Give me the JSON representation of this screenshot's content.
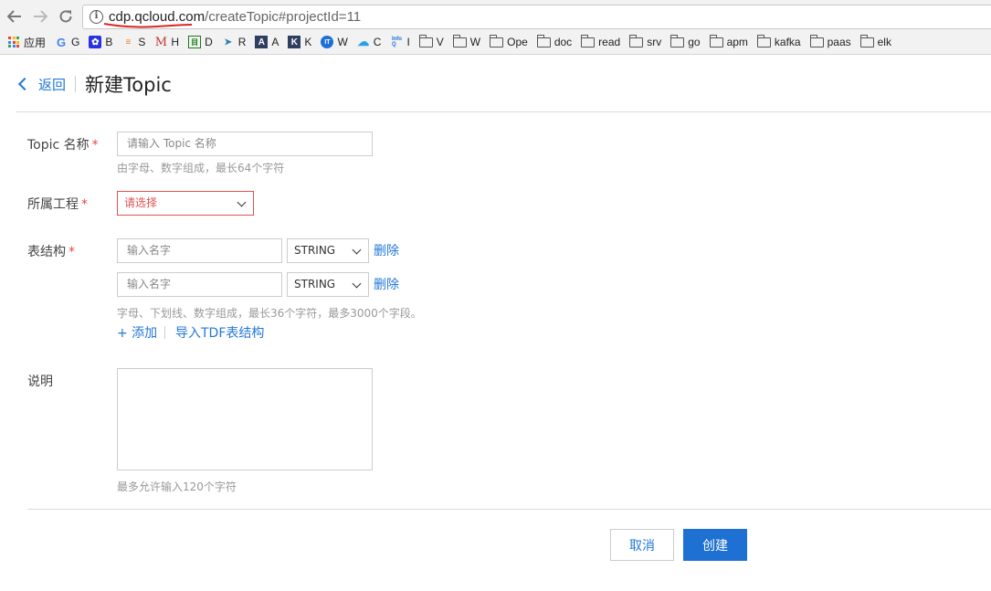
{
  "browser": {
    "url_host": "cdp.qcloud.com",
    "url_path": "/createTopic#projectId=11",
    "bookmarks": [
      {
        "icon": "apps-icon",
        "label": "应用"
      },
      {
        "icon": "google-icon",
        "label": "G"
      },
      {
        "icon": "baidu-paw-icon",
        "label": "B"
      },
      {
        "icon": "stack-icon",
        "label": "S"
      },
      {
        "icon": "m-logo-icon",
        "label": "H"
      },
      {
        "icon": "box-icon",
        "label": "D"
      },
      {
        "icon": "bird-icon",
        "label": "R"
      },
      {
        "icon": "a-logo-icon",
        "label": "A"
      },
      {
        "icon": "k-logo-icon",
        "label": "K"
      },
      {
        "icon": "it-icon",
        "label": "W"
      },
      {
        "icon": "cloud-icon",
        "label": "C"
      },
      {
        "icon": "infoq-icon",
        "label": "I"
      },
      {
        "icon": "folder-icon",
        "label": "V"
      },
      {
        "icon": "folder-icon",
        "label": "W"
      },
      {
        "icon": "folder-icon",
        "label": "Ope"
      },
      {
        "icon": "folder-icon",
        "label": "doc"
      },
      {
        "icon": "folder-icon",
        "label": "read"
      },
      {
        "icon": "folder-icon",
        "label": "srv"
      },
      {
        "icon": "folder-icon",
        "label": "go"
      },
      {
        "icon": "folder-icon",
        "label": "apm"
      },
      {
        "icon": "folder-icon",
        "label": "kafka"
      },
      {
        "icon": "folder-icon",
        "label": "paas"
      },
      {
        "icon": "folder-icon",
        "label": "elk"
      }
    ]
  },
  "header": {
    "back_label": "返回",
    "title": "新建Topic"
  },
  "form": {
    "topic_name": {
      "label": "Topic 名称",
      "required_mark": "*",
      "placeholder": "请输入 Topic 名称",
      "hint": "由字母、数字组成，最长64个字符"
    },
    "project": {
      "label": "所属工程",
      "required_mark": "*",
      "selected": "请选择"
    },
    "schema": {
      "label": "表结构",
      "required_mark": "*",
      "rows": [
        {
          "name_placeholder": "输入名字",
          "type": "STRING",
          "delete_label": "删除"
        },
        {
          "name_placeholder": "输入名字",
          "type": "STRING",
          "delete_label": "删除"
        }
      ],
      "hint": "字母、下划线、数字组成，最长36个字符，最多3000个字段。",
      "add_label": "+ 添加",
      "import_label": "导入TDF表结构"
    },
    "description": {
      "label": "说明",
      "hint": "最多允许输入120个字符"
    }
  },
  "actions": {
    "cancel_label": "取消",
    "create_label": "创建"
  },
  "colors": {
    "accent": "#2277da",
    "primary_button": "#1f70d3",
    "error": "#e15151",
    "required": "#e54545"
  }
}
